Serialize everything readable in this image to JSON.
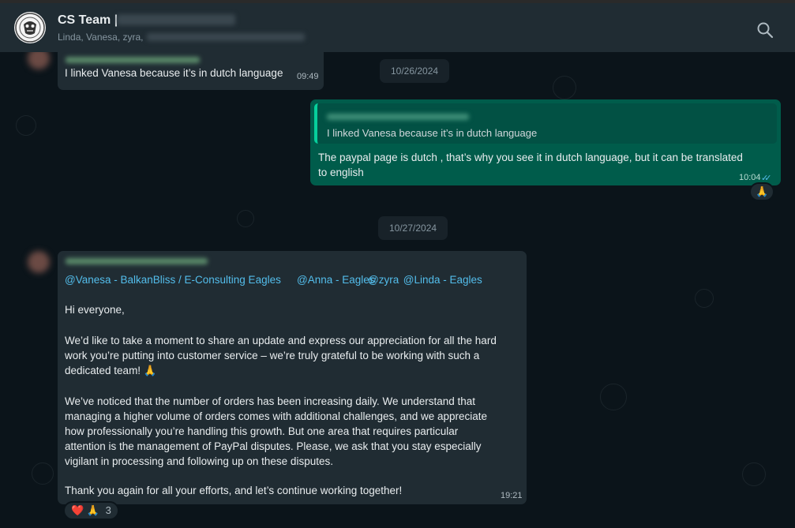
{
  "header": {
    "title": "CS Team |",
    "members": "Linda, Vanesa, zyra,",
    "search_icon": "search-icon"
  },
  "messages": {
    "m1": {
      "text": "I linked Vanesa because it’s in dutch language",
      "time": "09:49"
    },
    "date1": "10/26/2024",
    "m2": {
      "quote": "I linked Vanesa because it’s in dutch language",
      "text_line1": "The paypal page is dutch , that’s why you see it in dutch language, but it can be translated",
      "text_line2": "to english",
      "time": "10:04",
      "ticks": "✓✓",
      "reaction": "🙏"
    },
    "date2": "10/27/2024",
    "m3": {
      "mentions": [
        "@Vanesa - BalkanBliss / E-Consulting Eagles",
        "@Anna - Eagles",
        "@zyra",
        " @Linda - Eagles"
      ],
      "greeting": "Hi everyone,",
      "p1": [
        "We’d like to take a moment to share an update and express our appreciation for all the hard",
        "work you’re putting into customer service – we’re truly grateful to be working with such a",
        "dedicated team! 🙏"
      ],
      "p2": [
        "We’ve noticed that the number of orders has been increasing daily. We understand that",
        "managing a higher volume of orders comes with additional challenges, and we appreciate",
        "how professionally you’re handling this growth. But one area that requires particular",
        "attention is the management of PayPal disputes. Please, we ask that you stay especially",
        "vigilant in processing and following up on these disputes."
      ],
      "closing": "Thank you again for all your efforts, and let’s continue working together!",
      "time": "19:21",
      "reactions": "❤️ 🙏",
      "reaction_count": "3"
    }
  },
  "colors": {
    "incoming": "#202c33",
    "outgoing": "#005c4b",
    "mention": "#53bdeb",
    "background": "#0b141a"
  }
}
